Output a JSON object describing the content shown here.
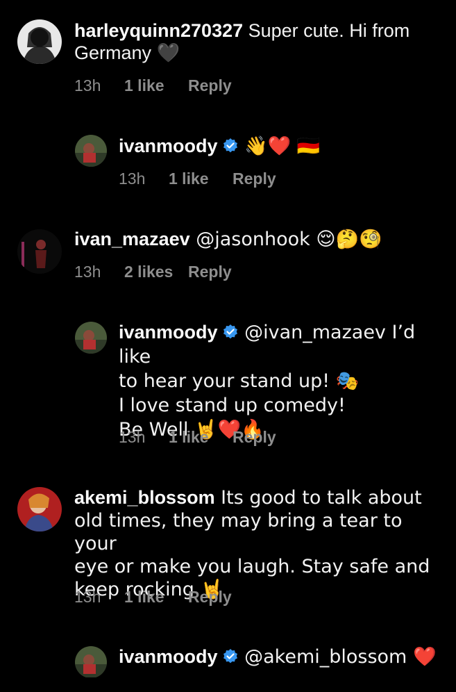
{
  "comments": [
    {
      "username": "harleyquinn270327",
      "text": " Super cute. Hi from\nGermany 🖤",
      "time": "13h",
      "likes": "1 like",
      "reply": "Reply"
    },
    {
      "username": "ivanmoody",
      "text": " 👋❤️ 🇩🇪",
      "time": "13h",
      "likes": "1 like",
      "reply": "Reply"
    },
    {
      "username": "ivan_mazaev",
      "text": " @jasonhook 😌🤔🧐",
      "time": "13h",
      "likes": "2 likes",
      "reply": "Reply"
    },
    {
      "username": "ivanmoody",
      "text": " @ivan_mazaev I’d like\nto hear your stand up! 🎭\nI love stand up comedy!\nBe Well 🤘❤️🔥",
      "time": "13h",
      "likes": "1 like",
      "reply": "Reply"
    },
    {
      "username": "akemi_blossom",
      "text": " Its good to talk about\nold times, they may bring a tear to your\neye or make you laugh. Stay safe and\nkeep rocking 🤘",
      "time": "13h",
      "likes": "1 like",
      "reply": "Reply"
    },
    {
      "username": "ivanmoody",
      "text": " @akemi_blossom ❤️",
      "time": "",
      "likes": "",
      "reply": ""
    }
  ],
  "colors": {
    "background": "#000000",
    "text": "#f2f2f2",
    "meta": "#8e8e8e",
    "verified": "#3897f0"
  }
}
